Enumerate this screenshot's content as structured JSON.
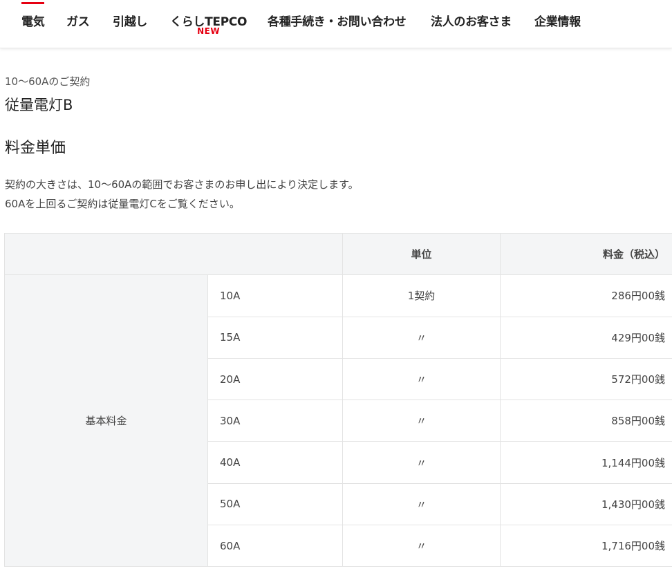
{
  "nav": {
    "items": [
      {
        "label": "電気",
        "active": true
      },
      {
        "label": "ガス"
      },
      {
        "label": "引越し"
      },
      {
        "label": "くらしTEPCO",
        "badge": "NEW"
      },
      {
        "label": "各種手続き・お問い合わせ"
      },
      {
        "label": "法人のお客さま"
      },
      {
        "label": "企業情報"
      }
    ],
    "accent_color": "#e60012"
  },
  "plan": {
    "eyebrow": "10～60Aのご契約",
    "title": "従量電灯B"
  },
  "section": {
    "title": "料金単価",
    "desc_line1": "契約の大きさは、10～60Aの範囲でお客さまのお申し出により決定します。",
    "desc_line2": "60Aを上回るご契約は従量電灯Cをご覧ください。"
  },
  "table": {
    "headers": {
      "label": "",
      "size": "",
      "unit": "単位",
      "price": "料金（税込）"
    },
    "group_label": "基本料金",
    "rows": [
      {
        "size": "10A",
        "unit": "1契約",
        "price": "286円00銭"
      },
      {
        "size": "15A",
        "unit": "〃",
        "price": "429円00銭"
      },
      {
        "size": "20A",
        "unit": "〃",
        "price": "572円00銭"
      },
      {
        "size": "30A",
        "unit": "〃",
        "price": "858円00銭"
      },
      {
        "size": "40A",
        "unit": "〃",
        "price": "1,144円00銭"
      },
      {
        "size": "50A",
        "unit": "〃",
        "price": "1,430円00銭"
      },
      {
        "size": "60A",
        "unit": "〃",
        "price": "1,716円00銭"
      }
    ]
  }
}
